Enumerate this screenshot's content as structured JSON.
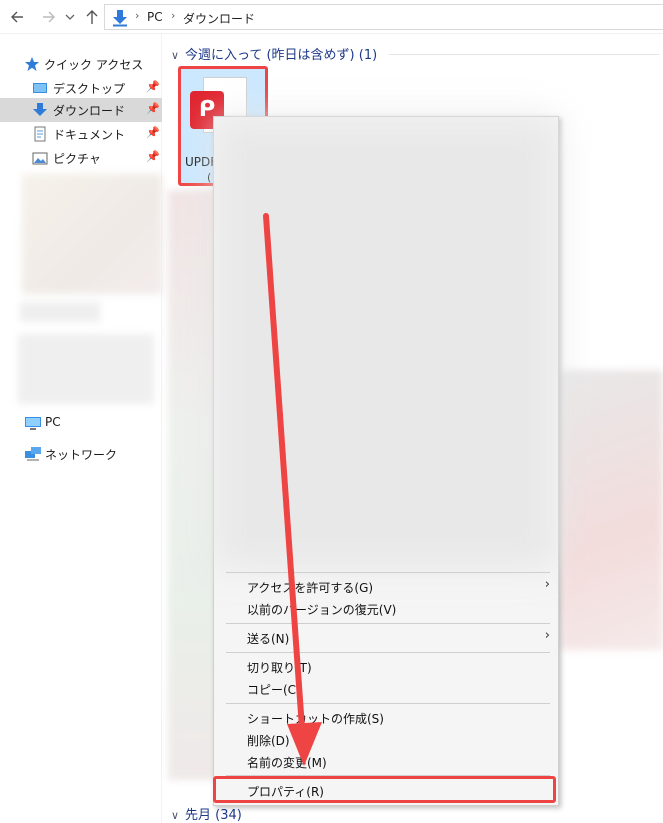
{
  "address_bar": {
    "back_icon": "left-arrow-icon",
    "forward_icon": "right-arrow-icon",
    "history_icon": "chevron-down-icon",
    "up_icon": "up-arrow-icon",
    "breadcrumbs": [
      "PC",
      "ダウンロード"
    ]
  },
  "sidebar": {
    "quick_access": "クイック アクセス",
    "items": [
      {
        "label": "デスクトップ",
        "icon": "desktop-icon"
      },
      {
        "label": "ダウンロード",
        "icon": "download-icon"
      },
      {
        "label": "ドキュメント",
        "icon": "document-icon"
      },
      {
        "label": "ピクチャ",
        "icon": "picture-icon"
      }
    ],
    "pc": "PC",
    "network": "ネットワーク"
  },
  "content": {
    "group_this_week": "今週に入って (昨日は含めず) (1)",
    "group_last_month": "先月 (34)",
    "file_name": "UPDF",
    "file_sub": "("
  },
  "context_menu": {
    "items": [
      {
        "label": "アクセスを許可する(G)",
        "submenu": true
      },
      {
        "label": "以前のバージョンの復元(V)",
        "submenu": false
      },
      {
        "label": "送る(N)",
        "submenu": true
      },
      {
        "label": "切り取り(T)",
        "submenu": false
      },
      {
        "label": "コピー(C)",
        "submenu": false
      },
      {
        "label": "ショートカットの作成(S)",
        "submenu": false
      },
      {
        "label": "削除(D)",
        "submenu": false
      },
      {
        "label": "名前の変更(M)",
        "submenu": false
      },
      {
        "label": "プロパティ(R)",
        "submenu": false
      }
    ]
  },
  "colors": {
    "selection": "#cce8ff",
    "highlight": "#ef4444",
    "group_header": "#1e3a8a",
    "updf_brand": "#e0242f"
  }
}
